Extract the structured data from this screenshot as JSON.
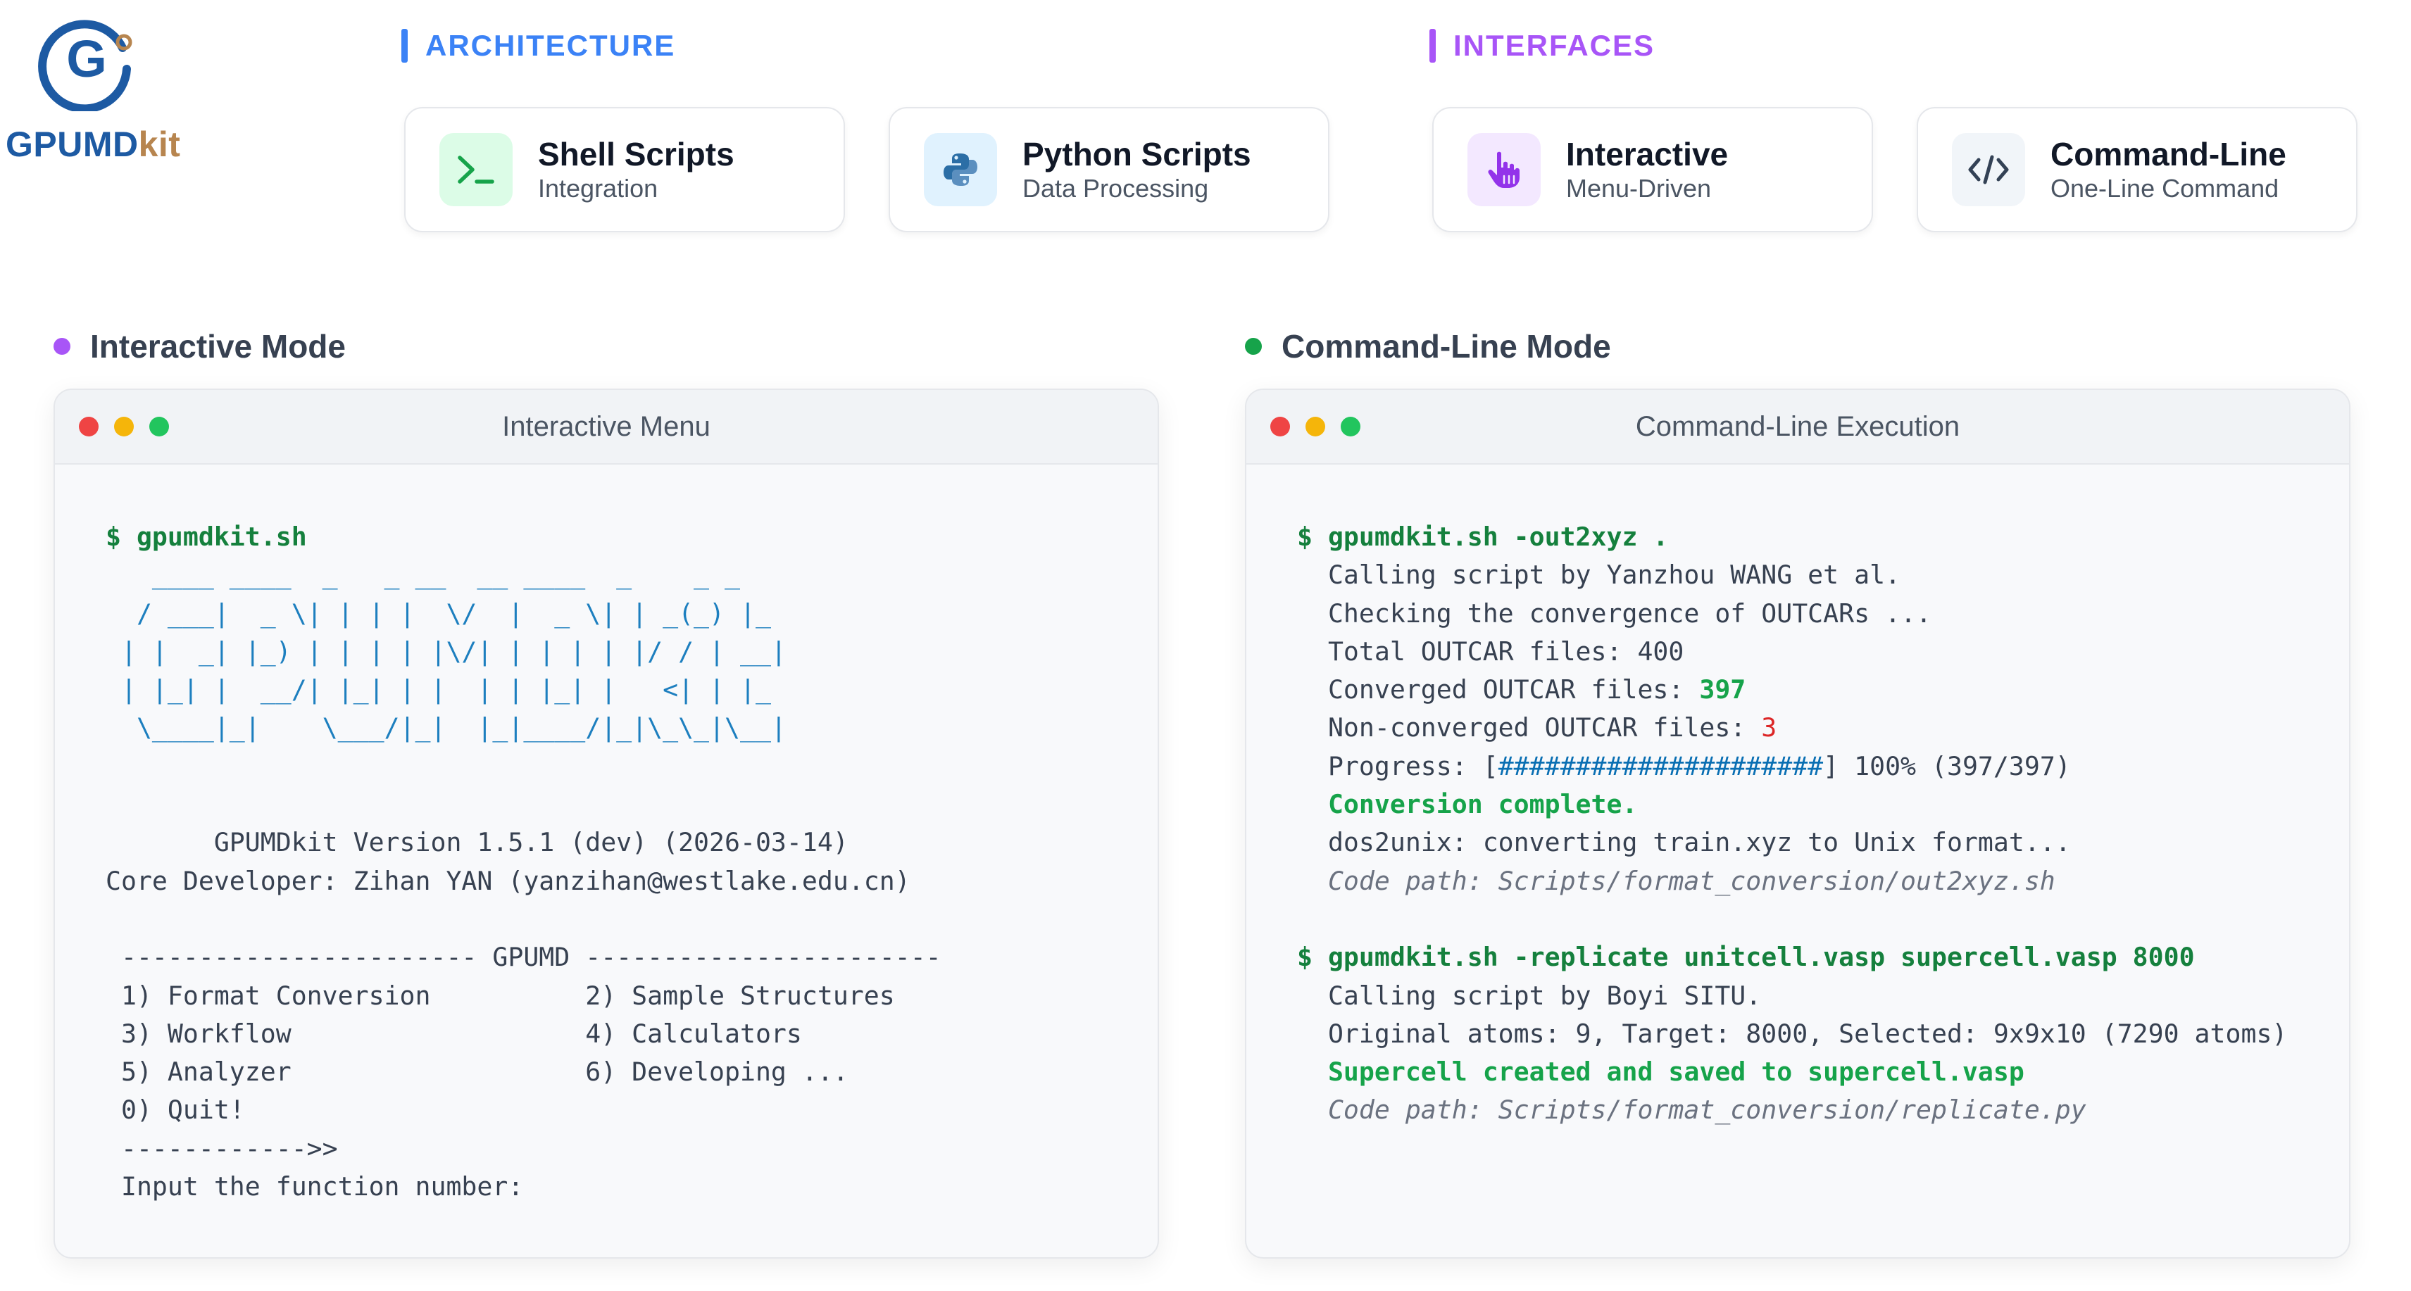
{
  "logo": {
    "letter": "G",
    "brand_main": "GPUMD",
    "brand_suffix": "kit",
    "colors": {
      "blue": "#1d5aa3",
      "gold": "#b7854f"
    }
  },
  "sections": {
    "architecture": {
      "title": "ARCHITECTURE",
      "color": "#3b82f6"
    },
    "interfaces": {
      "title": "INTERFACES",
      "color": "#a855f7"
    }
  },
  "cards": [
    {
      "icon": "terminal-icon",
      "title": "Shell Scripts",
      "subtitle": "Integration",
      "icon_bg": "#dcfce7",
      "icon_color": "#16a34a"
    },
    {
      "icon": "python-icon",
      "title": "Python Scripts",
      "subtitle": "Data Processing",
      "icon_bg": "#e0f2fe",
      "icon_color": "#2b6ea6"
    },
    {
      "icon": "pointer-hand-icon",
      "title": "Interactive",
      "subtitle": "Menu-Driven",
      "icon_bg": "#f3e8ff",
      "icon_color": "#9333ea"
    },
    {
      "icon": "code-icon",
      "title": "Command-Line",
      "subtitle": "One-Line Command",
      "icon_bg": "#f1f5f9",
      "icon_color": "#334155"
    }
  ],
  "modes": {
    "interactive": {
      "label": "Interactive Mode",
      "dot_color": "#a855f7"
    },
    "cli": {
      "label": "Command-Line Mode",
      "dot_color": "#16a34a"
    }
  },
  "windows": {
    "interactive": {
      "title": "Interactive Menu",
      "prompt": "$ gpumdkit.sh",
      "ascii_logo": "   ____ ____  _   _ __  __ ____  _    _ _   \n  / ___|  _ \\| | | |  \\/  |  _ \\| | _(_) |_ \n | |  _| |_) | | | | |\\/| | | | | |/ / | __|\n | |_| |  __/| |_| | |  | | |_| |   <| | |_ \n  \\____|_|    \\___/|_|  |_|____/|_|\\_\\_|\\__|",
      "version_line": "       GPUMDkit Version 1.5.1 (dev) (2026-03-14)",
      "developer_line": "Core Developer: Zihan YAN (yanzihan@westlake.edu.cn)",
      "menu_header": " ----------------------- GPUMD -----------------------",
      "menu_rows": [
        " 1) Format Conversion          2) Sample Structures",
        " 3) Workflow                   4) Calculators",
        " 5) Analyzer                   6) Developing ...",
        " 0) Quit!"
      ],
      "arrow_line": " ------------>>",
      "input_prompt": " Input the function number:"
    },
    "cli": {
      "title": "Command-Line Execution",
      "cmd1": {
        "prompt": "$ gpumdkit.sh -out2xyz .",
        "calling": "Calling script by Yanzhou WANG et al.",
        "checking": "Checking the convergence of OUTCARs ...",
        "total": "Total OUTCAR files: 400",
        "converged_label": "Converged OUTCAR files: ",
        "converged_value": "397",
        "nonconverged_label": "Non-converged OUTCAR files: ",
        "nonconverged_value": "3",
        "progress_label": "Progress: [",
        "progress_bar": "#####################",
        "progress_tail": "] 100% (397/397)",
        "progress_fraction": 1.0,
        "complete": "Conversion complete.",
        "dos2unix": "dos2unix: converting train.xyz to Unix format...",
        "code_path": "Code path: Scripts/format_conversion/out2xyz.sh"
      },
      "cmd2": {
        "prompt": "$ gpumdkit.sh -replicate unitcell.vasp supercell.vasp 8000",
        "calling": "Calling script by Boyi SITU.",
        "atoms": "Original atoms: 9, Target: 8000, Selected: 9x9x10 (7290 atoms)",
        "created": "Supercell created and saved to supercell.vasp",
        "code_path": "Code path: Scripts/format_conversion/replicate.py"
      }
    }
  },
  "traffic_lights": {
    "red": "#ef4444",
    "yellow": "#f5b50a",
    "green": "#22c55e"
  }
}
